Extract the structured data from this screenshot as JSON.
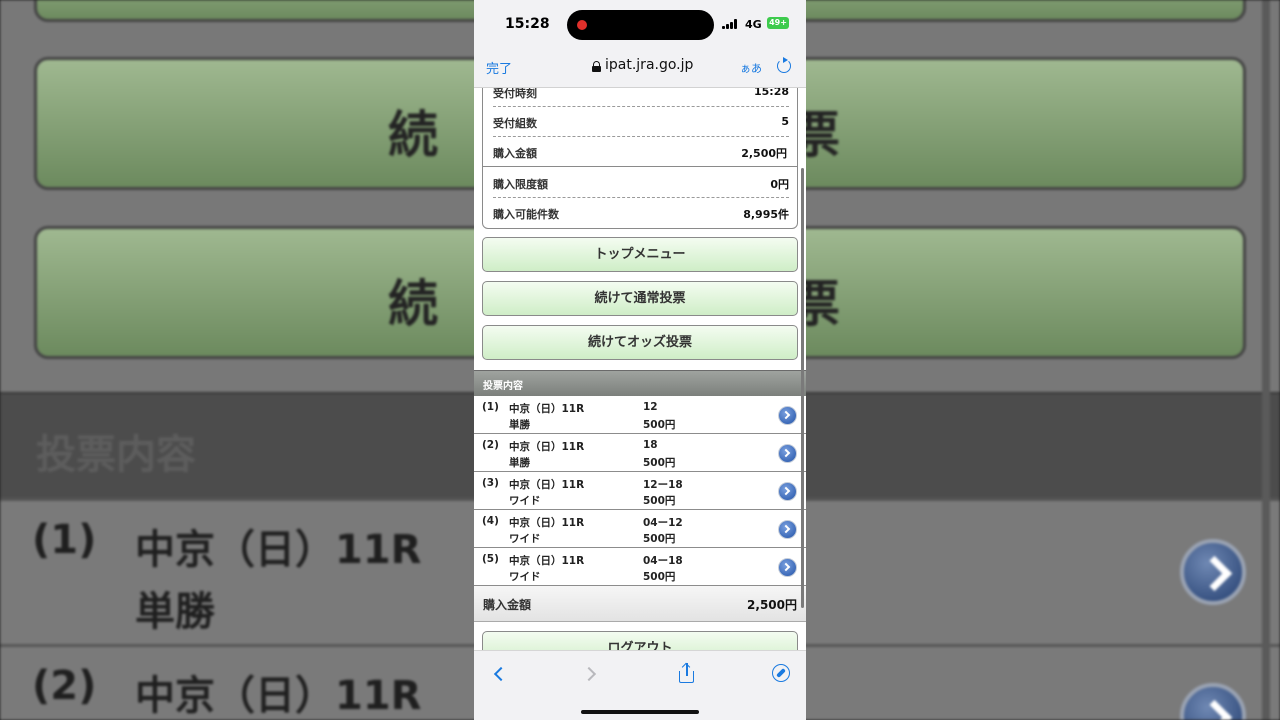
{
  "background": {
    "btn2_text_left": "続",
    "btn2_text_right": "票",
    "btn3_text_left": "続",
    "btn3_text_right": "票",
    "section_title": "投票内容",
    "row1": {
      "num": "(1)",
      "race": "中京（日）11R",
      "type": "単勝"
    },
    "row2": {
      "num": "(2)",
      "race": "中京（日）11R"
    }
  },
  "status_bar": {
    "time": "15:28",
    "network": "4G",
    "battery": "49+"
  },
  "url_bar": {
    "done_label": "完了",
    "domain": "ipat.jra.go.jp",
    "text_size_label": "ぁあ"
  },
  "summary": {
    "rows": [
      {
        "label": "受付時刻",
        "value": "15:28"
      },
      {
        "label": "受付組数",
        "value": "5"
      },
      {
        "label": "購入金額",
        "value": "2,500円"
      },
      {
        "label": "購入限度額",
        "value": "0円"
      },
      {
        "label": "購入可能件数",
        "value": "8,995件"
      }
    ]
  },
  "buttons": {
    "top_menu": "トップメニュー",
    "continue_normal": "続けて通常投票",
    "continue_odds": "続けてオッズ投票",
    "logout": "ログアウト"
  },
  "bets": {
    "section_title": "投票内容",
    "rows": [
      {
        "num": "(1)",
        "race": "中京（日）11R",
        "type": "単勝",
        "combo": "12",
        "amount": "500円"
      },
      {
        "num": "(2)",
        "race": "中京（日）11R",
        "type": "単勝",
        "combo": "18",
        "amount": "500円"
      },
      {
        "num": "(3)",
        "race": "中京（日）11R",
        "type": "ワイド",
        "combo": "12ー18",
        "amount": "500円"
      },
      {
        "num": "(4)",
        "race": "中京（日）11R",
        "type": "ワイド",
        "combo": "04ー12",
        "amount": "500円"
      },
      {
        "num": "(5)",
        "race": "中京（日）11R",
        "type": "ワイド",
        "combo": "04ー18",
        "amount": "500円"
      }
    ],
    "total_label": "購入金額",
    "total_value": "2,500円"
  },
  "toolbar_icons": [
    "back-icon",
    "forward-icon",
    "share-icon",
    "compass-icon"
  ]
}
